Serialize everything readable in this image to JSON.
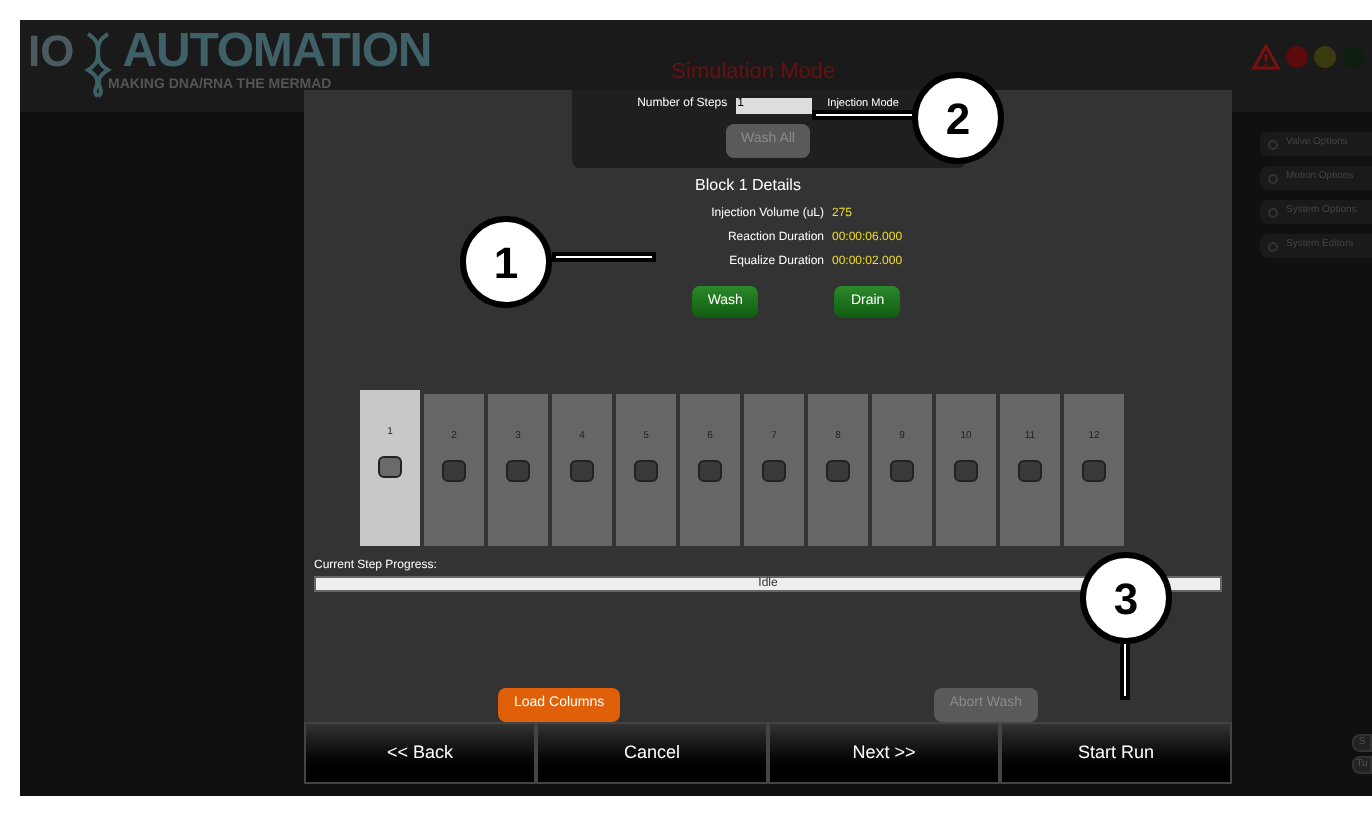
{
  "header": {
    "logo_prefix": "IO",
    "logo_name": "AUTOMATION",
    "tagline": "MAKING DNA/RNA THE MERMAD",
    "mode_title": "Simulation Mode"
  },
  "status_lights": [
    {
      "color": "#5a0a0a"
    },
    {
      "color": "#3a3a10"
    },
    {
      "color": "#0f1f0f"
    }
  ],
  "side_menu": [
    "Valve Options",
    "Motion Options",
    "System Options",
    "System Editors"
  ],
  "side_buttons": [
    "S",
    "Tu"
  ],
  "dialog": {
    "steps": {
      "label": "Number of Steps",
      "value": "1",
      "mode_label": "Injection Mode",
      "wash_all": {
        "label": "Wash All",
        "disabled": true
      }
    },
    "block_title": "Block 1 Details",
    "details": [
      {
        "label": "Injection Volume (uL)",
        "value": "275"
      },
      {
        "label": "Reaction Duration",
        "value": "00:00:06.000"
      },
      {
        "label": "Equalize Duration",
        "value": "00:00:02.000"
      }
    ],
    "actions": [
      "Wash",
      "Drain"
    ],
    "columns": [
      {
        "label": "1",
        "selected": true
      },
      {
        "label": "2",
        "selected": false
      },
      {
        "label": "3",
        "selected": false
      },
      {
        "label": "4",
        "selected": false
      },
      {
        "label": "5",
        "selected": false
      },
      {
        "label": "6",
        "selected": false
      },
      {
        "label": "7",
        "selected": false
      },
      {
        "label": "8",
        "selected": false
      },
      {
        "label": "9",
        "selected": false
      },
      {
        "label": "10",
        "selected": false
      },
      {
        "label": "11",
        "selected": false
      },
      {
        "label": "12",
        "selected": false
      }
    ],
    "progress": {
      "label": "Current Step Progress:",
      "status": "Idle",
      "level": 1
    },
    "load_columns": {
      "label": "Load Columns",
      "disabled": false
    },
    "abort_wash": {
      "label": "Abort Wash",
      "disabled": true
    },
    "footer": [
      "<< Back",
      "Cancel",
      "Next >>",
      "Start Run"
    ]
  },
  "callouts": [
    "1",
    "2",
    "3"
  ]
}
